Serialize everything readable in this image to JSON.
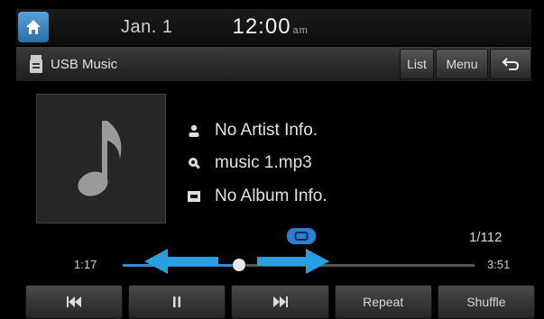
{
  "status": {
    "date": "Jan. 1",
    "time": "12:00",
    "ampm": "am"
  },
  "source": {
    "label": "USB Music"
  },
  "top_buttons": {
    "list": "List",
    "menu": "Menu"
  },
  "track": {
    "artist": "No Artist Info.",
    "title": "music 1.mp3",
    "album": "No Album Info.",
    "count": "1/112",
    "elapsed": "1:17",
    "total": "3:51",
    "progress": 0.33
  },
  "controls": {
    "repeat": "Repeat",
    "shuffle": "Shuffle"
  },
  "colors": {
    "accent": "#3e86d4",
    "arrow": "#2a9fe0"
  },
  "icons": [
    "home-icon",
    "usb-icon",
    "list-icon",
    "back-icon",
    "music-note-icon",
    "artist-icon",
    "file-icon",
    "album-icon",
    "repeat-icon",
    "previous-icon",
    "pause-icon",
    "next-icon"
  ]
}
